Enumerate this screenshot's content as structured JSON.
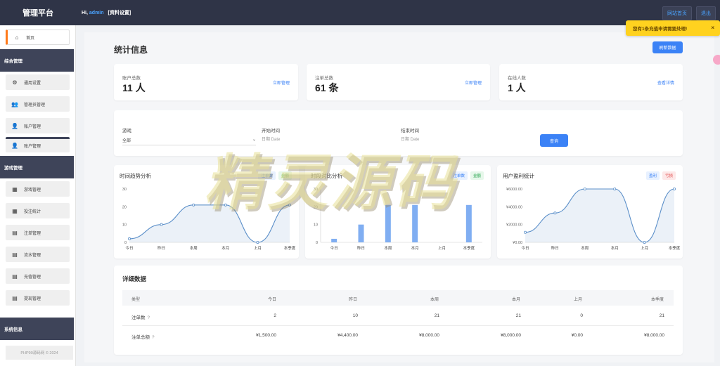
{
  "header": {
    "brand": "管理平台",
    "hi": "Hi,",
    "username": "admin",
    "profile_link": "[资料设置]",
    "site_home": "网站首页",
    "logout": "退出"
  },
  "sidebar": {
    "home": "首页",
    "section_general": "综合管理",
    "general_items": [
      "通用设置",
      "管理员管理",
      "账户管理",
      "账户管理"
    ],
    "section_game": "游戏管理",
    "game_items": [
      "游戏管理",
      "投注统计",
      "注单管理",
      "流水管理",
      "充值管理",
      "提现管理"
    ],
    "section_system": "系统信息",
    "copyright": "PHP90源码网 © 2024"
  },
  "page": {
    "title": "统计信息",
    "refresh": "刷新数据"
  },
  "stats": [
    {
      "label": "账户总数",
      "value": "11 人",
      "link": "立即管理"
    },
    {
      "label": "注单总数",
      "value": "61 条",
      "link": "立即管理"
    },
    {
      "label": "在线人数",
      "value": "1 人",
      "link": "查看详情"
    }
  ],
  "filter": {
    "game_label": "游戏",
    "game_value": "全部",
    "start_label": "开始时间",
    "start_placeholder": "日期 Date",
    "end_label": "结束时间",
    "end_placeholder": "日期 Date",
    "query": "查询"
  },
  "charts": {
    "trend": {
      "title": "时间趋势分析",
      "legend": [
        "注单数",
        "金额"
      ]
    },
    "period": {
      "title": "时段对比分析",
      "legend": [
        "注单数",
        "金额"
      ]
    },
    "profit": {
      "title": "用户盈利统计",
      "legend": [
        "盈利",
        "亏损"
      ]
    }
  },
  "chart_data": [
    {
      "type": "line",
      "title": "时间趋势分析",
      "categories": [
        "今日",
        "昨日",
        "本周",
        "本月",
        "上月",
        "本季度"
      ],
      "values": [
        2,
        10,
        21,
        21,
        0,
        21
      ],
      "yticks": [
        "0",
        "10",
        "20",
        "30"
      ],
      "ylim": [
        0,
        30
      ],
      "color": "#5b8fc9"
    },
    {
      "type": "bar",
      "title": "时段对比分析",
      "categories": [
        "今日",
        "昨日",
        "本周",
        "本月",
        "上月",
        "本季度"
      ],
      "values": [
        2,
        10,
        21,
        21,
        0,
        21
      ],
      "yticks": [
        "0",
        "10",
        "20",
        "30"
      ],
      "ylim": [
        0,
        30
      ],
      "color": "#6aa0f0"
    },
    {
      "type": "line",
      "title": "用户盈利统计",
      "categories": [
        "今日",
        "昨日",
        "本周",
        "本月",
        "上月",
        "本季度"
      ],
      "values": [
        1500,
        4400,
        8000,
        8000,
        0,
        8000
      ],
      "yticks": [
        "¥0.00",
        "¥2000.00",
        "¥4000.00",
        "¥6000.00"
      ],
      "ylim": [
        0,
        8000
      ],
      "color": "#5b8fc9"
    }
  ],
  "table": {
    "title": "详细数据",
    "headers": [
      "类型",
      "今日",
      "昨日",
      "本周",
      "本月",
      "上月",
      "本季度"
    ],
    "rows": [
      {
        "label": "注单数",
        "help": "?",
        "cells": [
          "2",
          "10",
          "21",
          "21",
          "0",
          "21"
        ]
      },
      {
        "label": "注单总额",
        "help": "?",
        "cells": [
          "¥1,500.00",
          "¥4,400.00",
          "¥8,000.00",
          "¥8,000.00",
          "¥0.00",
          "¥8,000.00"
        ]
      }
    ]
  },
  "toast": {
    "message": "您有1条充值申请需要处理!",
    "close": "×"
  },
  "watermark": "精灵源码",
  "colors": {
    "primary": "#3b82f6",
    "header": "#2f3447",
    "accent": "#ff7a1a",
    "toast": "#ffd21f"
  }
}
